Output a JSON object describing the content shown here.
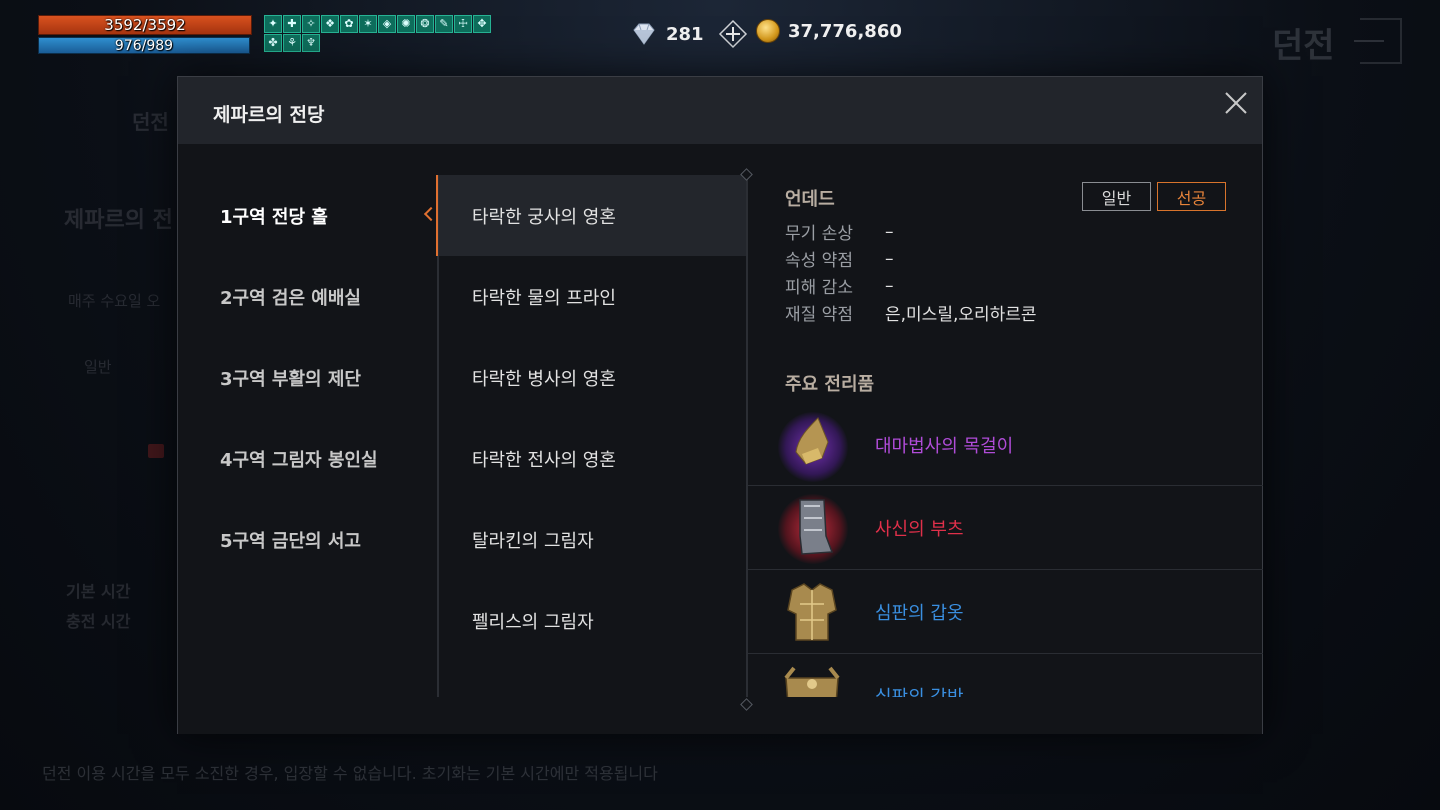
{
  "background": {
    "screen_title": "던전",
    "tab_label": "던전",
    "dungeon_name": "제파르의 전",
    "weekly_text": "매주 수요일 오",
    "difficulty_normal": "일반",
    "base_time_label": "기본 시간",
    "charge_time_label": "충전 시간",
    "notice": "던전 이용 시간을 모두 소진한 경우, 입장할 수 없습니다. 초기화는 기본 시간에만 적용됩니다"
  },
  "hud": {
    "hp": "3592/3592",
    "mp": "976/989",
    "hp_color": "#d9521f",
    "mp_color": "#2f8fcf",
    "buff_icons": [
      "buff-icon",
      "buff-icon",
      "buff-icon",
      "buff-icon",
      "buff-icon",
      "buff-icon",
      "buff-icon",
      "buff-icon",
      "buff-icon",
      "buff-icon",
      "buff-icon",
      "buff-icon",
      "buff-icon",
      "buff-icon"
    ],
    "diamonds": "281",
    "gold": "37,776,860"
  },
  "modal": {
    "title": "제파르의 전당",
    "zones": [
      {
        "label": "1구역 전당 홀",
        "active": true
      },
      {
        "label": "2구역 검은 예배실"
      },
      {
        "label": "3구역 부활의 제단"
      },
      {
        "label": "4구역 그림자 봉인실"
      },
      {
        "label": "5구역 금단의 서고"
      }
    ],
    "bosses": [
      {
        "label": "타락한 궁사의 영혼",
        "active": true
      },
      {
        "label": "타락한 물의 프라인"
      },
      {
        "label": "타락한 병사의 영혼"
      },
      {
        "label": "타락한 전사의 영혼"
      },
      {
        "label": "탈라킨의 그림자"
      },
      {
        "label": "펠리스의 그림자"
      }
    ],
    "info": {
      "race": "언데드",
      "difficulty_normal": "일반",
      "difficulty_hard": "선공",
      "stats": [
        {
          "label": "무기 손상",
          "value": "–"
        },
        {
          "label": "속성 약점",
          "value": "–"
        },
        {
          "label": "피해 감소",
          "value": "–"
        },
        {
          "label": "재질 약점",
          "value": "은,미스릴,오리하르콘"
        }
      ],
      "loot_title": "주요 전리품",
      "loot": [
        {
          "name": "대마법사의 목걸이",
          "color": "#b04cd8",
          "icon": "necklace-icon"
        },
        {
          "name": "사신의 부츠",
          "color": "#e0304a",
          "icon": "boots-icon"
        },
        {
          "name": "심판의 갑옷",
          "color": "#3a8fe0",
          "icon": "armor-icon"
        },
        {
          "name": "심판의 각반",
          "color": "#3a8fe0",
          "icon": "leggings-icon"
        }
      ],
      "accent_color": "#e07030"
    }
  }
}
